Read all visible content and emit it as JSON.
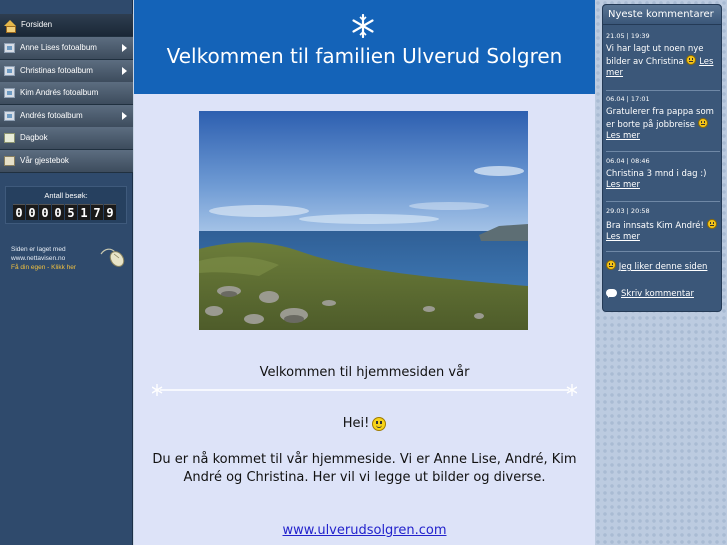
{
  "sidebar": {
    "items": [
      {
        "label": "Forsiden"
      },
      {
        "label": "Anne Lises fotoalbum"
      },
      {
        "label": "Christinas fotoalbum"
      },
      {
        "label": "Kim Andrés fotoalbum"
      },
      {
        "label": "Andrés fotoalbum"
      },
      {
        "label": "Dagbok"
      },
      {
        "label": "Vår gjestebok"
      }
    ],
    "counter": {
      "label": "Antall besøk:",
      "digits": [
        "0",
        "0",
        "0",
        "0",
        "5",
        "1",
        "7",
        "9"
      ]
    },
    "credit": {
      "line1": "Siden er laget med",
      "line2": "www.nettavisen.no",
      "link": "Få din egen - Klikk her"
    }
  },
  "header": {
    "title": "Velkommen til familien Ulverud Solgren"
  },
  "main": {
    "welcome": "Velkommen til hjemmesiden vår",
    "greeting": "Hei!",
    "intro": "Du er nå kommet til vår hjemmeside. Vi er Anne Lise, André, Kim André og Christina. Her vil vi legge ut bilder og diverse.",
    "link": "www.ulverudsolgren.com"
  },
  "comments": {
    "title": "Nyeste kommentarer",
    "read_more": "Les mer",
    "items": [
      {
        "time": "21.05 | 19:39",
        "text": "Vi har lagt ut noen nye bilder av Christina"
      },
      {
        "time": "06.04 | 17:01",
        "text": "Gratulerer fra pappa som er borte på jobbreise"
      },
      {
        "time": "06.04 | 08:46",
        "text": "Christina 3 mnd i dag :)"
      },
      {
        "time": "29.03 | 20:58",
        "text": "Bra innsats Kim André!"
      }
    ],
    "like": "Jeg liker denne siden",
    "write": "Skriv kommentar"
  }
}
